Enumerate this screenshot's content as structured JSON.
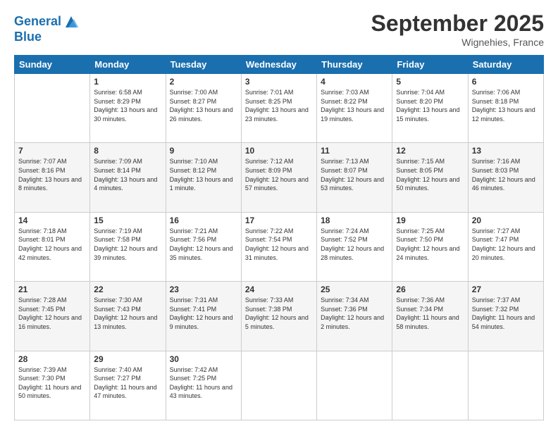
{
  "header": {
    "logo_line1": "General",
    "logo_line2": "Blue",
    "month": "September 2025",
    "location": "Wignehies, France"
  },
  "weekdays": [
    "Sunday",
    "Monday",
    "Tuesday",
    "Wednesday",
    "Thursday",
    "Friday",
    "Saturday"
  ],
  "weeks": [
    [
      {
        "day": "",
        "sunrise": "",
        "sunset": "",
        "daylight": ""
      },
      {
        "day": "1",
        "sunrise": "Sunrise: 6:58 AM",
        "sunset": "Sunset: 8:29 PM",
        "daylight": "Daylight: 13 hours and 30 minutes."
      },
      {
        "day": "2",
        "sunrise": "Sunrise: 7:00 AM",
        "sunset": "Sunset: 8:27 PM",
        "daylight": "Daylight: 13 hours and 26 minutes."
      },
      {
        "day": "3",
        "sunrise": "Sunrise: 7:01 AM",
        "sunset": "Sunset: 8:25 PM",
        "daylight": "Daylight: 13 hours and 23 minutes."
      },
      {
        "day": "4",
        "sunrise": "Sunrise: 7:03 AM",
        "sunset": "Sunset: 8:22 PM",
        "daylight": "Daylight: 13 hours and 19 minutes."
      },
      {
        "day": "5",
        "sunrise": "Sunrise: 7:04 AM",
        "sunset": "Sunset: 8:20 PM",
        "daylight": "Daylight: 13 hours and 15 minutes."
      },
      {
        "day": "6",
        "sunrise": "Sunrise: 7:06 AM",
        "sunset": "Sunset: 8:18 PM",
        "daylight": "Daylight: 13 hours and 12 minutes."
      }
    ],
    [
      {
        "day": "7",
        "sunrise": "Sunrise: 7:07 AM",
        "sunset": "Sunset: 8:16 PM",
        "daylight": "Daylight: 13 hours and 8 minutes."
      },
      {
        "day": "8",
        "sunrise": "Sunrise: 7:09 AM",
        "sunset": "Sunset: 8:14 PM",
        "daylight": "Daylight: 13 hours and 4 minutes."
      },
      {
        "day": "9",
        "sunrise": "Sunrise: 7:10 AM",
        "sunset": "Sunset: 8:12 PM",
        "daylight": "Daylight: 13 hours and 1 minute."
      },
      {
        "day": "10",
        "sunrise": "Sunrise: 7:12 AM",
        "sunset": "Sunset: 8:09 PM",
        "daylight": "Daylight: 12 hours and 57 minutes."
      },
      {
        "day": "11",
        "sunrise": "Sunrise: 7:13 AM",
        "sunset": "Sunset: 8:07 PM",
        "daylight": "Daylight: 12 hours and 53 minutes."
      },
      {
        "day": "12",
        "sunrise": "Sunrise: 7:15 AM",
        "sunset": "Sunset: 8:05 PM",
        "daylight": "Daylight: 12 hours and 50 minutes."
      },
      {
        "day": "13",
        "sunrise": "Sunrise: 7:16 AM",
        "sunset": "Sunset: 8:03 PM",
        "daylight": "Daylight: 12 hours and 46 minutes."
      }
    ],
    [
      {
        "day": "14",
        "sunrise": "Sunrise: 7:18 AM",
        "sunset": "Sunset: 8:01 PM",
        "daylight": "Daylight: 12 hours and 42 minutes."
      },
      {
        "day": "15",
        "sunrise": "Sunrise: 7:19 AM",
        "sunset": "Sunset: 7:58 PM",
        "daylight": "Daylight: 12 hours and 39 minutes."
      },
      {
        "day": "16",
        "sunrise": "Sunrise: 7:21 AM",
        "sunset": "Sunset: 7:56 PM",
        "daylight": "Daylight: 12 hours and 35 minutes."
      },
      {
        "day": "17",
        "sunrise": "Sunrise: 7:22 AM",
        "sunset": "Sunset: 7:54 PM",
        "daylight": "Daylight: 12 hours and 31 minutes."
      },
      {
        "day": "18",
        "sunrise": "Sunrise: 7:24 AM",
        "sunset": "Sunset: 7:52 PM",
        "daylight": "Daylight: 12 hours and 28 minutes."
      },
      {
        "day": "19",
        "sunrise": "Sunrise: 7:25 AM",
        "sunset": "Sunset: 7:50 PM",
        "daylight": "Daylight: 12 hours and 24 minutes."
      },
      {
        "day": "20",
        "sunrise": "Sunrise: 7:27 AM",
        "sunset": "Sunset: 7:47 PM",
        "daylight": "Daylight: 12 hours and 20 minutes."
      }
    ],
    [
      {
        "day": "21",
        "sunrise": "Sunrise: 7:28 AM",
        "sunset": "Sunset: 7:45 PM",
        "daylight": "Daylight: 12 hours and 16 minutes."
      },
      {
        "day": "22",
        "sunrise": "Sunrise: 7:30 AM",
        "sunset": "Sunset: 7:43 PM",
        "daylight": "Daylight: 12 hours and 13 minutes."
      },
      {
        "day": "23",
        "sunrise": "Sunrise: 7:31 AM",
        "sunset": "Sunset: 7:41 PM",
        "daylight": "Daylight: 12 hours and 9 minutes."
      },
      {
        "day": "24",
        "sunrise": "Sunrise: 7:33 AM",
        "sunset": "Sunset: 7:38 PM",
        "daylight": "Daylight: 12 hours and 5 minutes."
      },
      {
        "day": "25",
        "sunrise": "Sunrise: 7:34 AM",
        "sunset": "Sunset: 7:36 PM",
        "daylight": "Daylight: 12 hours and 2 minutes."
      },
      {
        "day": "26",
        "sunrise": "Sunrise: 7:36 AM",
        "sunset": "Sunset: 7:34 PM",
        "daylight": "Daylight: 11 hours and 58 minutes."
      },
      {
        "day": "27",
        "sunrise": "Sunrise: 7:37 AM",
        "sunset": "Sunset: 7:32 PM",
        "daylight": "Daylight: 11 hours and 54 minutes."
      }
    ],
    [
      {
        "day": "28",
        "sunrise": "Sunrise: 7:39 AM",
        "sunset": "Sunset: 7:30 PM",
        "daylight": "Daylight: 11 hours and 50 minutes."
      },
      {
        "day": "29",
        "sunrise": "Sunrise: 7:40 AM",
        "sunset": "Sunset: 7:27 PM",
        "daylight": "Daylight: 11 hours and 47 minutes."
      },
      {
        "day": "30",
        "sunrise": "Sunrise: 7:42 AM",
        "sunset": "Sunset: 7:25 PM",
        "daylight": "Daylight: 11 hours and 43 minutes."
      },
      {
        "day": "",
        "sunrise": "",
        "sunset": "",
        "daylight": ""
      },
      {
        "day": "",
        "sunrise": "",
        "sunset": "",
        "daylight": ""
      },
      {
        "day": "",
        "sunrise": "",
        "sunset": "",
        "daylight": ""
      },
      {
        "day": "",
        "sunrise": "",
        "sunset": "",
        "daylight": ""
      }
    ]
  ]
}
